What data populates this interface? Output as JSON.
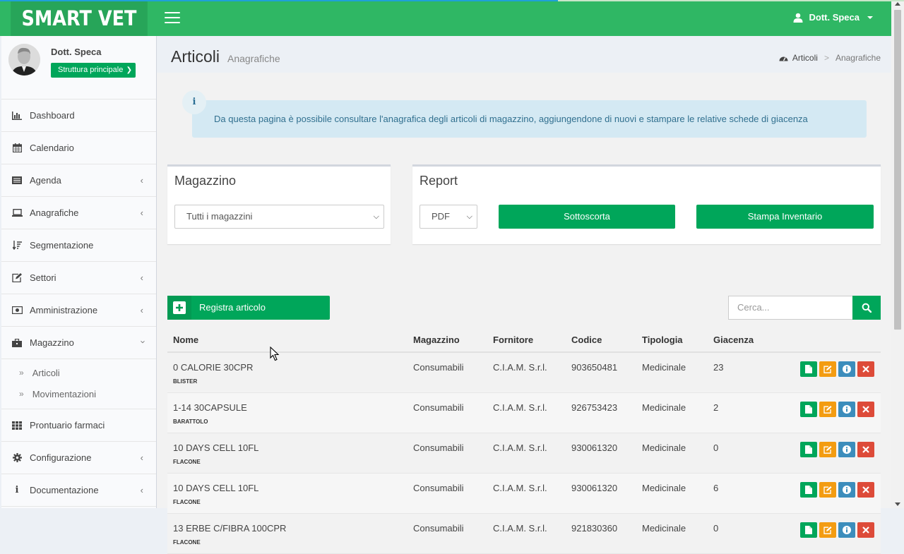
{
  "brand": {
    "logo": "SMART VET",
    "accent": "#2fb764",
    "dark_accent": "#27a559",
    "button_green": "#00a65a"
  },
  "header": {
    "user_label": "Dott. Speca"
  },
  "sidebar": {
    "user_name": "Dott. Speca",
    "structure_select": "Struttura principale",
    "items": [
      {
        "label": "Dashboard",
        "icon": "bar-chart-icon"
      },
      {
        "label": "Calendario",
        "icon": "calendar-icon"
      },
      {
        "label": "Agenda",
        "icon": "list-icon"
      },
      {
        "label": "Anagrafiche",
        "icon": "laptop-icon"
      },
      {
        "label": "Segmentazione",
        "icon": "sort-icon"
      },
      {
        "label": "Settori",
        "icon": "edit-icon"
      },
      {
        "label": "Amministrazione",
        "icon": "money-icon"
      },
      {
        "label": "Magazzino",
        "icon": "briefcase-icon"
      },
      {
        "label": "Prontuario farmaci",
        "icon": "grid-icon"
      },
      {
        "label": "Configurazione",
        "icon": "gear-icon"
      },
      {
        "label": "Documentazione",
        "icon": "info-icon"
      }
    ],
    "submenu": [
      {
        "label": "Articoli"
      },
      {
        "label": "Movimentazioni"
      }
    ]
  },
  "page": {
    "title": "Articoli",
    "subtitle": "Anagrafiche",
    "breadcrumb": {
      "home": "Articoli",
      "separator": ">",
      "current": "Anagrafiche"
    },
    "callout": "Da questa pagina è possibile consultare l'anagrafica degli articoli di magazzino, aggiungendone di nuovi e stampare le relative schede di giacenza",
    "callout_icon": "i"
  },
  "magazzino_box": {
    "title": "Magazzino",
    "select_value": "Tutti i magazzini"
  },
  "report_box": {
    "title": "Report",
    "format_value": "PDF",
    "sottoscorta_label": "Sottoscorta",
    "inventario_label": "Stampa Inventario"
  },
  "toolbar": {
    "register_label": "Registra articolo",
    "search_placeholder": "Cerca..."
  },
  "table": {
    "columns": [
      "Nome",
      "Magazzino",
      "Fornitore",
      "Codice",
      "Tipologia",
      "Giacenza"
    ],
    "rows": [
      {
        "nome": "0 CALORIE 30CPR",
        "confezione": "BLISTER",
        "magazzino": "Consumabili",
        "fornitore": "C.I.A.M. S.r.l.",
        "codice": "903650481",
        "tipologia": "Medicinale",
        "giacenza": "23"
      },
      {
        "nome": "1-14 30CAPSULE",
        "confezione": "BARATTOLO",
        "magazzino": "Consumabili",
        "fornitore": "C.I.A.M. S.r.l.",
        "codice": "926753423",
        "tipologia": "Medicinale",
        "giacenza": "2"
      },
      {
        "nome": "10 DAYS CELL 10FL",
        "confezione": "FLACONE",
        "magazzino": "Consumabili",
        "fornitore": "C.I.A.M. S.r.l.",
        "codice": "930061320",
        "tipologia": "Medicinale",
        "giacenza": "0"
      },
      {
        "nome": "10 DAYS CELL 10FL",
        "confezione": "FLACONE",
        "magazzino": "Consumabili",
        "fornitore": "C.I.A.M. S.r.l.",
        "codice": "930061320",
        "tipologia": "Medicinale",
        "giacenza": "6"
      },
      {
        "nome": "13 ERBE C/FIBRA 100CPR",
        "confezione": "FLACONE",
        "magazzino": "Consumabili",
        "fornitore": "C.I.A.M. S.r.l.",
        "codice": "921830360",
        "tipologia": "Medicinale",
        "giacenza": "0"
      }
    ]
  }
}
